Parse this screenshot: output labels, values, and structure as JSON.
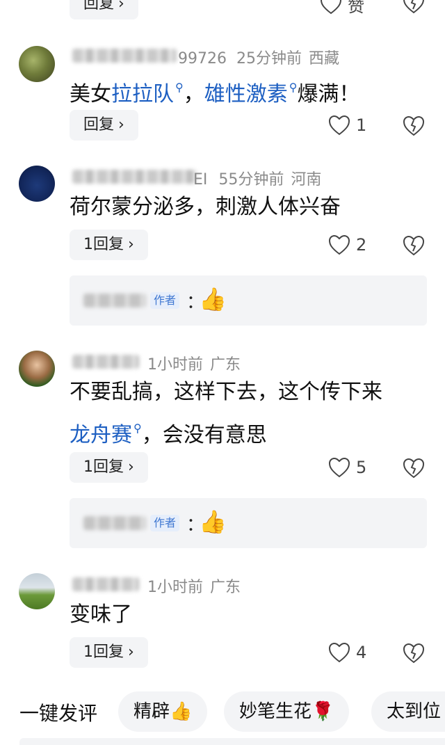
{
  "top_partial": {
    "reply_label": "回复",
    "like_label": "赞"
  },
  "comments": [
    {
      "username_tail": "99726",
      "time": "25分钟前",
      "location": "西藏",
      "text_parts": [
        "美女",
        "拉拉队",
        "，",
        "雄性激素",
        "爆满！"
      ],
      "reply_label": "回复",
      "likes": "1"
    },
    {
      "username_tail": "EI",
      "time": "55分钟前",
      "location": "河南",
      "text": "荷尔蒙分泌多，刺激人体兴奋",
      "reply_label": "1回复",
      "likes": "2",
      "author_reply": {
        "tag": "作者",
        "colon": "：",
        "emoji": "👍"
      }
    },
    {
      "time": "1小时前",
      "location": "广东",
      "text_line1": "不要乱搞，这样下去，这个传下来",
      "text_line2_link": "龙舟赛",
      "text_line2_rest": "，会没有意思",
      "reply_label": "1回复",
      "likes": "5",
      "author_reply": {
        "tag": "作者",
        "colon": "：",
        "emoji": "👍"
      }
    },
    {
      "time": "1小时前",
      "location": "广东",
      "text": "变味了",
      "reply_label": "1回复",
      "likes": "4"
    }
  ],
  "quick_bar": {
    "label": "一键发评",
    "chips": [
      {
        "text": "精辟",
        "emoji": "👍"
      },
      {
        "text": "妙笔生花",
        "emoji": "🌹"
      },
      {
        "text": "太到位",
        "emoji": ""
      }
    ]
  },
  "icons": {
    "search_link": "search-icon",
    "like": "heart-icon",
    "dislike": "broken-heart-icon",
    "chevron": "chevron-right-icon"
  }
}
